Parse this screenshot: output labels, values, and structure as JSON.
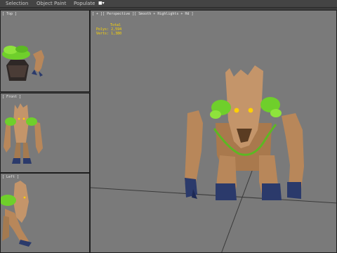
{
  "menubar": {
    "items": [
      {
        "label": "Selection"
      },
      {
        "label": "Object Paint"
      },
      {
        "label": "Populate"
      }
    ],
    "icon": "viewport-icon"
  },
  "viewports": {
    "top": {
      "label": "[ Top ]"
    },
    "front": {
      "label": "[ Front ]"
    },
    "left": {
      "label": "[ Left ]"
    },
    "perspective": {
      "label": "[ + ][ Perspective ][ Smooth + Highlights + Hd ]"
    }
  },
  "stats": {
    "title": "Total",
    "polys_label": "Polys:",
    "polys": "2,594",
    "verts_label": "Verts:",
    "verts": "1,380"
  },
  "colors": {
    "background": "#3c3c3c",
    "viewport": "#7a7a7a",
    "grid": "#3a3a3a",
    "wood": "#b8875a",
    "leaves": "#6fcf2b",
    "eyes": "#ffd000",
    "stats_text": "#ffd700"
  }
}
